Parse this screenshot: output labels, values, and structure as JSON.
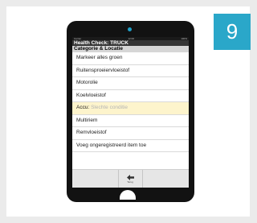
{
  "badge": {
    "number": "9"
  },
  "colors": {
    "accent": "#2aa7c9",
    "highlight": "#fdf4cc",
    "app_bar": "#353535"
  },
  "status_bar": {
    "left": "Carrier",
    "center": "12:00",
    "right": "100%"
  },
  "app": {
    "title": "Health Check: TRUCK"
  },
  "section": {
    "header": "Categorie & Locatie"
  },
  "items": [
    {
      "label": "Markeer alles groen"
    },
    {
      "label": "Ruitensproeiervloeistof"
    },
    {
      "label": "Motorolie"
    },
    {
      "label": "Koelvloeistof"
    },
    {
      "label": "Accu:",
      "condition": "Slechte conditie",
      "highlighted": true
    },
    {
      "label": "Multiriem"
    },
    {
      "label": "Remvloeistof"
    },
    {
      "label": "Voeg ongeregistreerd item toe"
    }
  ],
  "toolbar": {
    "back_label": "Terug",
    "back_icon": "back-arrow-icon"
  }
}
